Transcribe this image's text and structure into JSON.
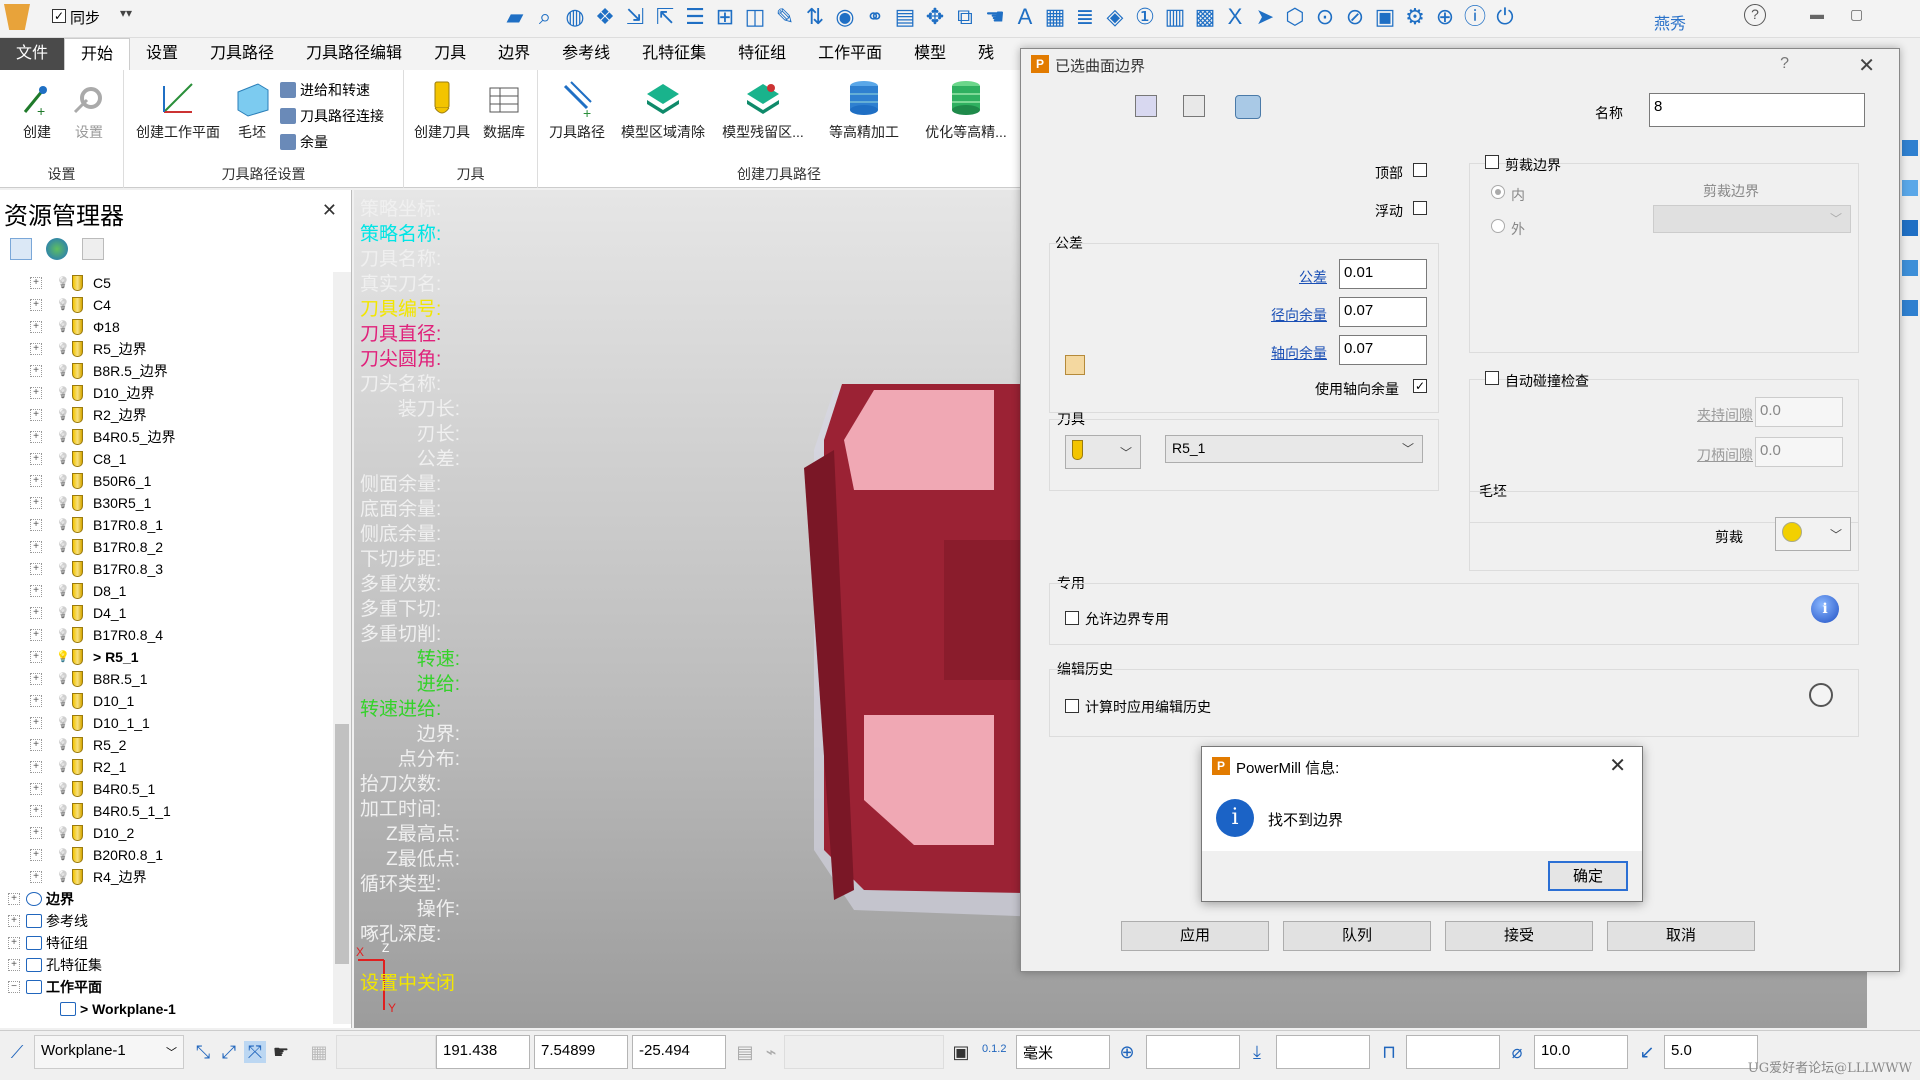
{
  "titlebar": {
    "sync_label": "同步",
    "user_name": "燕秀",
    "help": "?"
  },
  "ribbon": {
    "tabs": [
      {
        "label": "文件"
      },
      {
        "label": "开始"
      },
      {
        "label": "设置"
      },
      {
        "label": "刀具路径"
      },
      {
        "label": "刀具路径编辑"
      },
      {
        "label": "刀具"
      },
      {
        "label": "边界"
      },
      {
        "label": "参考线"
      },
      {
        "label": "孔特征集"
      },
      {
        "label": "特征组"
      },
      {
        "label": "工作平面"
      },
      {
        "label": "模型"
      },
      {
        "label": "残"
      }
    ],
    "create": "创建",
    "settings": "设置",
    "group_setup": "设置",
    "create_workplane": "创建工作平面",
    "blank": "毛坯",
    "lead_in": "进给和转速",
    "toolpath_connect": "刀具路径连接",
    "allowance": "余量",
    "group_toolpath_setup": "刀具路径设置",
    "create_tool": "创建刀具",
    "database": "数据库",
    "group_tool": "刀具",
    "toolpath": "刀具路径",
    "model_area_clear": "模型区域清除",
    "model_rest_area": "模型残留区...",
    "constant_z": "等高精加工",
    "optimized_z": "优化等高精...",
    "group_create_toolpath": "创建刀具路径"
  },
  "explorer": {
    "title": "资源管理器",
    "tools": [
      {
        "name": "C5",
        "active": false
      },
      {
        "name": "C4",
        "active": false
      },
      {
        "name": "Φ18",
        "active": false
      },
      {
        "name": "R5_边界",
        "active": false
      },
      {
        "name": "B8R.5_边界",
        "active": false
      },
      {
        "name": "D10_边界",
        "active": false
      },
      {
        "name": "R2_边界",
        "active": false
      },
      {
        "name": "B4R0.5_边界",
        "active": false
      },
      {
        "name": "C8_1",
        "active": false
      },
      {
        "name": "B50R6_1",
        "active": false
      },
      {
        "name": "B30R5_1",
        "active": false
      },
      {
        "name": "B17R0.8_1",
        "active": false
      },
      {
        "name": "B17R0.8_2",
        "active": false
      },
      {
        "name": "B17R0.8_3",
        "active": false
      },
      {
        "name": "D8_1",
        "active": false
      },
      {
        "name": "D4_1",
        "active": false
      },
      {
        "name": "B17R0.8_4",
        "active": false
      },
      {
        "name": "> R5_1",
        "active": true
      },
      {
        "name": "B8R.5_1",
        "active": false
      },
      {
        "name": "D10_1",
        "active": false
      },
      {
        "name": "D10_1_1",
        "active": false
      },
      {
        "name": "R5_2",
        "active": false
      },
      {
        "name": "R2_1",
        "active": false
      },
      {
        "name": "B4R0.5_1",
        "active": false
      },
      {
        "name": "B4R0.5_1_1",
        "active": false
      },
      {
        "name": "D10_2",
        "active": false
      },
      {
        "name": "B20R0.8_1",
        "active": false
      },
      {
        "name": "R4_边界",
        "active": false
      }
    ],
    "folders": [
      {
        "name": "边界"
      },
      {
        "name": "参考线"
      },
      {
        "name": "特征组"
      },
      {
        "name": "孔特征集"
      },
      {
        "name": "工作平面"
      },
      {
        "name": "> Workplane-1"
      }
    ]
  },
  "viewport": {
    "info_rows": [
      {
        "label": "策略坐标:",
        "color": "#f0f0f0",
        "align": "left"
      },
      {
        "label": "策略名称:",
        "color": "#00e5e5",
        "align": "left"
      },
      {
        "label": "刀具名称:",
        "color": "#f0f0f0",
        "align": "left"
      },
      {
        "label": "真实刀名:",
        "color": "#f0f0f0",
        "align": "left"
      },
      {
        "label": "刀具编号:",
        "color": "#f2e600",
        "align": "left"
      },
      {
        "label": "刀具直径:",
        "color": "#e0207a",
        "align": "left"
      },
      {
        "label": "刀尖圆角:",
        "color": "#e0207a",
        "align": "left"
      },
      {
        "label": "刀头名称:",
        "color": "#f0f0f0",
        "align": "left"
      },
      {
        "label": "装刀长:",
        "color": "#f0f0f0",
        "align": "right"
      },
      {
        "label": "刃长:",
        "color": "#f0f0f0",
        "align": "right"
      },
      {
        "label": "公差:",
        "color": "#f0f0f0",
        "align": "right"
      },
      {
        "label": "侧面余量:",
        "color": "#f0f0f0",
        "align": "left"
      },
      {
        "label": "底面余量:",
        "color": "#f0f0f0",
        "align": "left"
      },
      {
        "label": "侧底余量:",
        "color": "#f0f0f0",
        "align": "left"
      },
      {
        "label": "下切步距:",
        "color": "#f0f0f0",
        "align": "left"
      },
      {
        "label": "多重次数:",
        "color": "#f0f0f0",
        "align": "left"
      },
      {
        "label": "多重下切:",
        "color": "#f0f0f0",
        "align": "left"
      },
      {
        "label": "多重切削:",
        "color": "#f0f0f0",
        "align": "left"
      },
      {
        "label": "转速:",
        "color": "#34d22a",
        "align": "right"
      },
      {
        "label": "进给:",
        "color": "#34d22a",
        "align": "right"
      },
      {
        "label": "转速进给:",
        "color": "#34d22a",
        "align": "left"
      },
      {
        "label": "边界:",
        "color": "#f0f0f0",
        "align": "right"
      },
      {
        "label": "点分布:",
        "color": "#f0f0f0",
        "align": "right"
      },
      {
        "label": "抬刀次数:",
        "color": "#f0f0f0",
        "align": "left"
      },
      {
        "label": "加工时间:",
        "color": "#f0f0f0",
        "align": "left"
      },
      {
        "label": "Z最高点:",
        "color": "#f0f0f0",
        "align": "right"
      },
      {
        "label": "Z最低点:",
        "color": "#f0f0f0",
        "align": "right"
      },
      {
        "label": "循环类型:",
        "color": "#f0f0f0",
        "align": "left"
      },
      {
        "label": "操作:",
        "color": "#f0f0f0",
        "align": "right"
      },
      {
        "label": "啄孔深度:",
        "color": "#f0f0f0",
        "align": "left"
      }
    ],
    "status_text": "设置中关闭",
    "axis_z": "Z",
    "axis_x": "X",
    "axis_y": "Y"
  },
  "dialog": {
    "title": "已选曲面边界",
    "help": "?",
    "name_label": "名称",
    "name_value": "8",
    "top_label": "顶部",
    "float_label": "浮动",
    "tolerance_group": "公差",
    "tolerance_label": "公差",
    "tolerance_value": "0.01",
    "radial_label": "径向余量",
    "radial_value": "0.07",
    "axial_label": "轴向余量",
    "axial_value": "0.07",
    "use_axial_label": "使用轴向余量",
    "tool_group": "刀具",
    "tool_value": "R5_1",
    "trim_boundary_label": "剪裁边界",
    "inside_label": "内",
    "outside_label": "外",
    "trim_boundary_sub": "剪裁边界",
    "auto_collision_label": "自动碰撞检查",
    "holder_clearance_label": "夹持间隙",
    "holder_clearance_value": "0.0",
    "shank_clearance_label": "刀柄间隙",
    "shank_clearance_value": "0.0",
    "blank_group": "毛坯",
    "trim_label": "剪裁",
    "special_group": "专用",
    "allow_special_label": "允许边界专用",
    "edit_history_group": "编辑历史",
    "apply_history_label": "计算时应用编辑历史",
    "apply_button": "应用",
    "queue_button": "队列",
    "accept_button": "接受",
    "cancel_button": "取消"
  },
  "msgbox": {
    "title": "PowerMill 信息:",
    "message": "找不到边界",
    "ok_button": "确定"
  },
  "statusbar": {
    "workplane": "Workplane-1",
    "x": "191.438",
    "y": "7.54899",
    "z": "-25.494",
    "units": "毫米",
    "diameter": "10.0",
    "stepover": "5.0",
    "digits": "0.1.2"
  },
  "watermark": "UG爱好者论坛@LLLWWW",
  "colors": {
    "accent": "#1f6fc4",
    "model_red": "#9b2234",
    "model_pink": "#f0a8b4"
  }
}
